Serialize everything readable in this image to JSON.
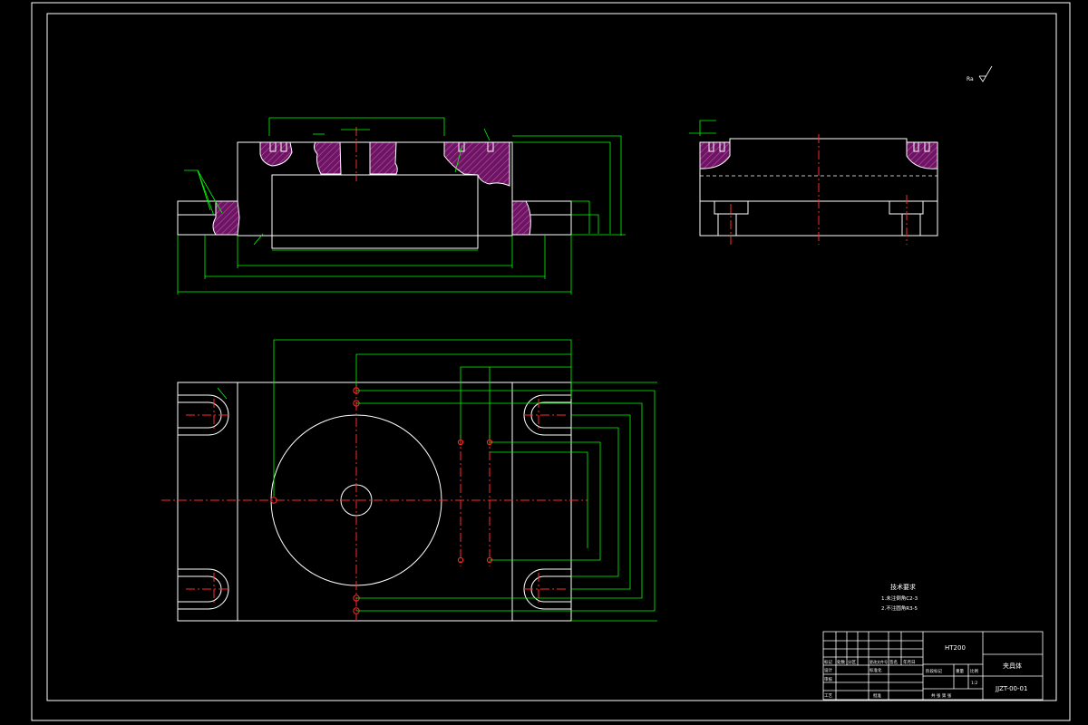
{
  "surface_finish": {
    "label": "Ra"
  },
  "tech_requirements": {
    "title": "技术要求",
    "lines": [
      "1.未注倒角C2-3",
      "2.不注圆角R3-5"
    ]
  },
  "title_block": {
    "material": "HT200",
    "part_name": "夹具体",
    "drawing_no": "JJZT-00-01",
    "cells": {
      "mark": "标记",
      "count": "处数",
      "zone": "分区",
      "change_doc": "更改文件号",
      "signature": "签名",
      "date": "年月日",
      "design": "设计",
      "standardize": "标准化",
      "review": "审核",
      "process": "工艺",
      "approve": "批准",
      "stage_mark": "阶段标记",
      "weight": "重量",
      "scale": "比例",
      "scale_value": "1:2",
      "sheet": "共 张 第 张"
    }
  },
  "colors": {
    "outline": "#ffffff",
    "dimension": "#00ff00",
    "centerline": "#ff2a2a",
    "section_fill": "#7a1a6a"
  }
}
